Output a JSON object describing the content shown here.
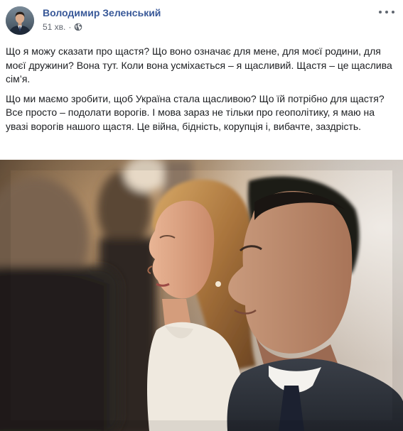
{
  "post": {
    "author": "Володимир Зеленський",
    "time": "51 хв.",
    "separator": "·",
    "audience_icon": "globe-icon",
    "menu_icon": "more-options-icon",
    "paragraphs": [
      "Що я можу сказати про щастя? Що воно означає для мене, для моєї родини, для моєї дружини? Вона тут. Коли вона усміхається – я щасливий. Щастя – це щаслива сім’я.",
      "Що ми маємо зробити, щоб Україна стала щасливою? Що їй потрібно для щастя? Все просто – подолати ворогів. І мова зараз не тільки про геополітику, я маю на увазі ворогів нашого щастя. Це війна, бідність, корупція і, вибачте, заздрість."
    ]
  },
  "colors": {
    "author": "#385898",
    "text": "#1c1e21",
    "meta": "#616770"
  }
}
